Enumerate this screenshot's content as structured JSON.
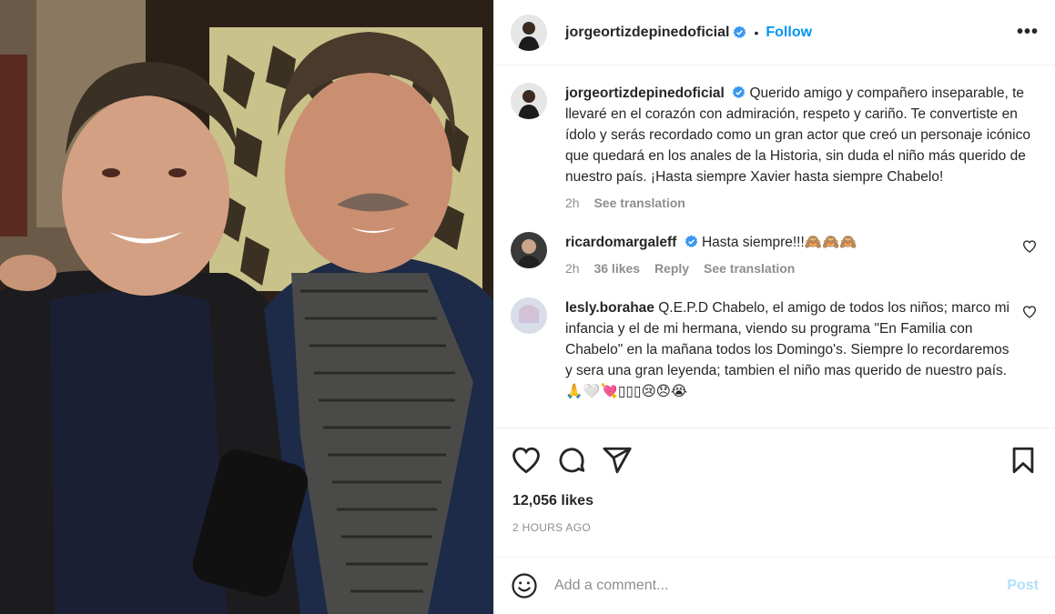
{
  "post": {
    "author": "jorgeortizdepinedoficial",
    "follow_label": "Follow",
    "separator": "•",
    "more_label": "•••",
    "caption": "Querido amigo y compañero inseparable, te llevaré en el corazón con admiración, respeto y cariño. Te convertiste en ídolo y serás recordado como un gran actor que creó un personaje icónico que quedará en los anales de la Historia, sin duda el niño más querido de nuestro país. ¡Hasta siempre Xavier hasta siempre Chabelo!",
    "caption_time": "2h",
    "caption_translate": "See translation",
    "likes": "12,056 likes",
    "posted": "2 HOURS AGO"
  },
  "comments": [
    {
      "user": "ricardomargaleff",
      "text": "Hasta siempre!!!🙈🙈🙈",
      "time": "2h",
      "likes": "36 likes",
      "reply": "Reply",
      "translate": "See translation"
    },
    {
      "user": "lesly.borahae",
      "text": "Q.E.P.D Chabelo, el amigo de todos los niños; marco mi infancia y el de mi hermana, viendo su programa \"En Familia con Chabelo\" en la mañana todos los Domingo's. Siempre lo recordaremos y sera una gran leyenda; tambien el niño mas querido de nuestro país. 🙏🤍💘▯▯▯😢😞😭"
    }
  ],
  "composer": {
    "placeholder": "Add a comment...",
    "post_label": "Post"
  },
  "icons": {
    "verified": "verified-badge-icon",
    "like": "heart-icon",
    "comment": "comment-bubble-icon",
    "share": "paper-plane-icon",
    "save": "bookmark-icon",
    "emoji": "smiley-icon",
    "more": "more-options-icon"
  },
  "colors": {
    "link": "#0095f6",
    "verified": "#3897f0",
    "muted": "#8e8e8e",
    "post_disabled": "#b2dffc"
  }
}
